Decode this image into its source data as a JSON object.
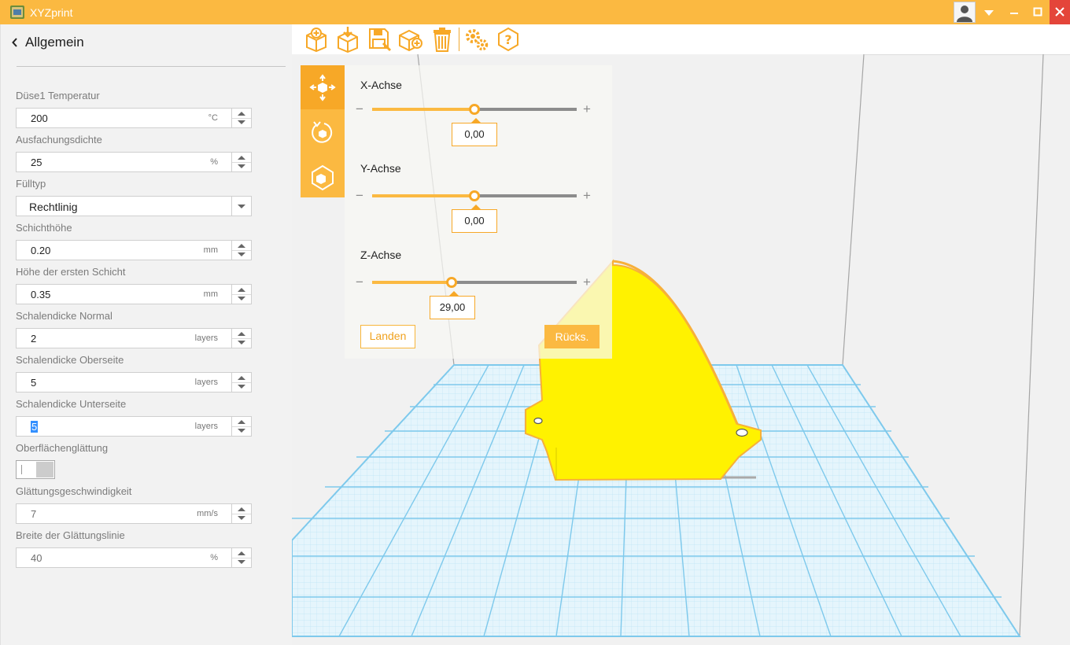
{
  "app": {
    "title": "XYZprint"
  },
  "colors": {
    "accent": "#fbb941",
    "accent_dark": "#f7a827",
    "close": "#e4453a",
    "model": "#fff200",
    "grid": "#8fd0ee"
  },
  "icons": {
    "toolbar": [
      "import-model-icon",
      "load-project-icon",
      "save-project-icon",
      "add-object-icon",
      "delete-icon",
      "settings-icon",
      "help-icon"
    ],
    "modes": [
      "move-icon",
      "rotate-icon",
      "scale-icon"
    ]
  },
  "sidebar": {
    "back_title": "Allgemein",
    "fields": [
      {
        "label": "Düse1 Temperatur",
        "value": "200",
        "unit": "°C",
        "type": "number"
      },
      {
        "label": "Ausfachungsdichte",
        "value": "25",
        "unit": "%",
        "type": "number"
      },
      {
        "label": "Fülltyp",
        "value": "Rechtlinig",
        "unit": "",
        "type": "select"
      },
      {
        "label": "Schichthöhe",
        "value": "0.20",
        "unit": "mm",
        "type": "number"
      },
      {
        "label": "Höhe der ersten Schicht",
        "value": "0.35",
        "unit": "mm",
        "type": "number"
      },
      {
        "label": "Schalendicke Normal",
        "value": "2",
        "unit": "layers",
        "type": "number"
      },
      {
        "label": "Schalendicke Oberseite",
        "value": "5",
        "unit": "layers",
        "type": "number"
      },
      {
        "label": "Schalendicke Unterseite",
        "value": "5",
        "unit": "layers",
        "type": "number"
      },
      {
        "label": "Oberflächenglättung",
        "value": "",
        "unit": "",
        "type": "toggle",
        "on": false
      },
      {
        "label": "Glättungsgeschwindigkeit",
        "value": "7",
        "unit": "mm/s",
        "type": "number"
      },
      {
        "label": "Breite der Glättungslinie",
        "value": "40",
        "unit": "%",
        "type": "number"
      }
    ]
  },
  "transform": {
    "x": {
      "label": "X-Achse",
      "value": "0,00",
      "level": 0.5
    },
    "y": {
      "label": "Y-Achse",
      "value": "0,00",
      "level": 0.5
    },
    "z": {
      "label": "Z-Achse",
      "value": "29,00",
      "level": 0.39
    },
    "land_label": "Landen",
    "reset_label": "Rücks."
  }
}
